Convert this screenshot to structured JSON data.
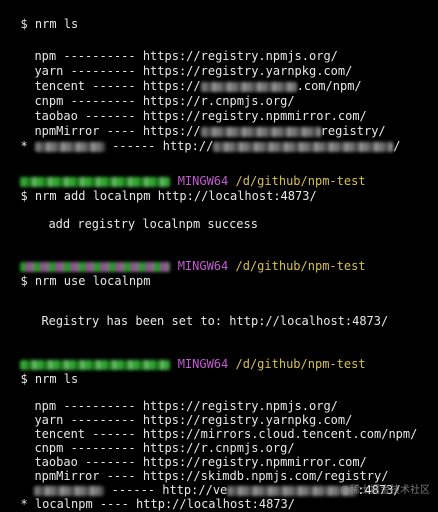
{
  "session1": {
    "command": "$ nrm ls",
    "registries": [
      {
        "line": "npm ---------- https://registry.npmjs.org/"
      },
      {
        "line": "yarn --------- https://registry.yarnpkg.com/"
      },
      {
        "line_a": "tencent ------ https://",
        "line_b": ".com/npm/"
      },
      {
        "line": "cnpm --------- https://r.cnpmjs.org/"
      },
      {
        "line": "taobao ------- https://registry.npmmirror.com/"
      },
      {
        "line_a": "npmMirror ---- https://",
        "line_b": "registry/"
      },
      {
        "prefix": "*",
        "line_a": " ------ http://",
        "line_b": "/"
      }
    ]
  },
  "prompt_env": "MINGW64",
  "prompt_path": "/d/github/npm-test",
  "session2": {
    "command": "$ nrm add localnpm http://localhost:4873/",
    "output": "add registry localnpm success"
  },
  "session3": {
    "command": "$ nrm use localnpm",
    "output": "Registry has been set to: http://localhost:4873/"
  },
  "session4": {
    "command": "$ nrm ls",
    "registries": [
      {
        "line": "npm ---------- https://registry.npmjs.org/"
      },
      {
        "line": "yarn --------- https://registry.yarnpkg.com/"
      },
      {
        "line": "tencent ------ https://mirrors.cloud.tencent.com/npm/"
      },
      {
        "line": "cnpm --------- https://r.cnpmjs.org/"
      },
      {
        "line": "taobao ------- https://registry.npmmirror.com/"
      },
      {
        "line": "npmMirror ---- https://skimdb.npmjs.com/registry/"
      },
      {
        "line_a": " ------ http://ve",
        "line_b": ":4873/"
      },
      {
        "prefix": "*",
        "line": " localnpm ---- http://localhost:4873/"
      }
    ]
  },
  "watermark": "@稀土掘金技术社区"
}
